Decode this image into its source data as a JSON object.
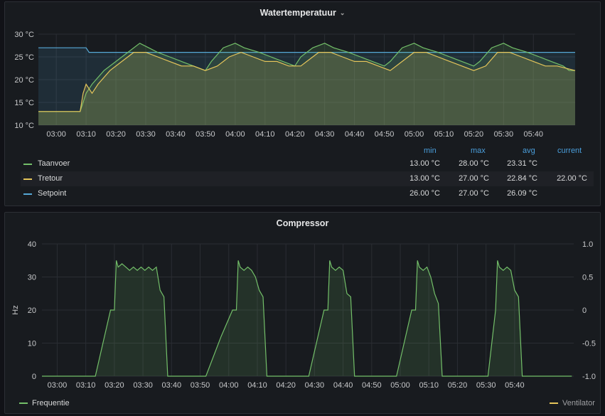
{
  "colors": {
    "taanvoer": "#73bf69",
    "tretour": "#e5c55a",
    "setpoint": "#56a8d6",
    "frequentie": "#73bf69",
    "ventilator": "#e5c55a"
  },
  "panel_top": {
    "title": "Watertemperatuur",
    "caret_icon": "chevron-down-icon",
    "y_ticks": [
      "30 °C",
      "25 °C",
      "20 °C",
      "15 °C",
      "10 °C"
    ],
    "x_ticks": [
      "03:00",
      "03:10",
      "03:20",
      "03:30",
      "03:40",
      "03:50",
      "04:00",
      "04:10",
      "04:20",
      "04:30",
      "04:40",
      "04:50",
      "05:00",
      "05:10",
      "05:20",
      "05:30",
      "05:40"
    ],
    "legend_headers": {
      "min": "min",
      "max": "max",
      "avg": "avg",
      "current": "current"
    },
    "legend": [
      {
        "name": "Taanvoer",
        "min": "13.00 °C",
        "max": "28.00 °C",
        "avg": "23.31 °C",
        "current": ""
      },
      {
        "name": "Tretour",
        "min": "13.00 °C",
        "max": "27.00 °C",
        "avg": "22.84 °C",
        "current": "22.00 °C"
      },
      {
        "name": "Setpoint",
        "min": "26.00 °C",
        "max": "27.00 °C",
        "avg": "26.09 °C",
        "current": ""
      }
    ]
  },
  "panel_bottom": {
    "title": "Compressor",
    "y_left_label": "Hz",
    "y_left_ticks": [
      "40",
      "30",
      "20",
      "10",
      "0"
    ],
    "y_right_ticks": [
      "1.0",
      "0.5",
      "0",
      "-0.5",
      "-1.0"
    ],
    "x_ticks": [
      "03:00",
      "03:10",
      "03:20",
      "03:30",
      "03:40",
      "03:50",
      "04:00",
      "04:10",
      "04:20",
      "04:30",
      "04:40",
      "04:50",
      "05:00",
      "05:10",
      "05:20",
      "05:30",
      "05:40"
    ],
    "legend_left": "Frequentie",
    "legend_right": "Ventilator"
  },
  "chart_data": [
    {
      "type": "line",
      "title": "Watertemperatuur",
      "ylim": [
        10,
        30
      ],
      "x_unit": "minutes since 02:54",
      "series": [
        {
          "name": "Taanvoer",
          "points": [
            [
              0,
              13
            ],
            [
              14,
              13
            ],
            [
              16,
              17
            ],
            [
              18,
              19
            ],
            [
              22,
              22
            ],
            [
              26,
              24
            ],
            [
              30,
              26
            ],
            [
              34,
              28
            ],
            [
              37,
              27
            ],
            [
              40,
              26
            ],
            [
              44,
              25
            ],
            [
              48,
              24
            ],
            [
              52,
              23
            ],
            [
              56,
              22
            ],
            [
              58,
              24
            ],
            [
              62,
              27
            ],
            [
              66,
              28
            ],
            [
              69,
              27
            ],
            [
              74,
              26
            ],
            [
              78,
              25
            ],
            [
              82,
              24
            ],
            [
              86,
              23
            ],
            [
              88,
              25
            ],
            [
              92,
              27
            ],
            [
              96,
              28
            ],
            [
              99,
              27
            ],
            [
              104,
              26
            ],
            [
              108,
              25
            ],
            [
              112,
              24
            ],
            [
              116,
              23
            ],
            [
              118,
              24
            ],
            [
              122,
              27
            ],
            [
              126,
              28
            ],
            [
              129,
              27
            ],
            [
              134,
              26
            ],
            [
              138,
              25
            ],
            [
              142,
              24
            ],
            [
              146,
              23
            ],
            [
              148,
              24
            ],
            [
              152,
              27
            ],
            [
              156,
              28
            ],
            [
              159,
              27
            ],
            [
              164,
              26
            ],
            [
              168,
              25
            ],
            [
              172,
              24
            ],
            [
              176,
              23
            ],
            [
              178,
              22
            ],
            [
              180,
              22
            ]
          ]
        },
        {
          "name": "Tretour",
          "points": [
            [
              0,
              13
            ],
            [
              14,
              13
            ],
            [
              15,
              17
            ],
            [
              16,
              19
            ],
            [
              17,
              18
            ],
            [
              18,
              17
            ],
            [
              20,
              19
            ],
            [
              24,
              22
            ],
            [
              28,
              24
            ],
            [
              32,
              26
            ],
            [
              36,
              26
            ],
            [
              40,
              25
            ],
            [
              44,
              24
            ],
            [
              48,
              23
            ],
            [
              52,
              23
            ],
            [
              56,
              22
            ],
            [
              60,
              23
            ],
            [
              64,
              25
            ],
            [
              68,
              26
            ],
            [
              72,
              25
            ],
            [
              76,
              24
            ],
            [
              80,
              24
            ],
            [
              84,
              23
            ],
            [
              88,
              23
            ],
            [
              90,
              24
            ],
            [
              94,
              26
            ],
            [
              98,
              26
            ],
            [
              102,
              25
            ],
            [
              106,
              24
            ],
            [
              110,
              24
            ],
            [
              114,
              23
            ],
            [
              118,
              22
            ],
            [
              122,
              24
            ],
            [
              126,
              26
            ],
            [
              130,
              26
            ],
            [
              134,
              25
            ],
            [
              138,
              24
            ],
            [
              142,
              23
            ],
            [
              146,
              22
            ],
            [
              150,
              23
            ],
            [
              154,
              26
            ],
            [
              158,
              26
            ],
            [
              162,
              25
            ],
            [
              166,
              24
            ],
            [
              170,
              23
            ],
            [
              174,
              23
            ],
            [
              180,
              22
            ]
          ]
        },
        {
          "name": "Setpoint",
          "points": [
            [
              0,
              27
            ],
            [
              16,
              27
            ],
            [
              17,
              26
            ],
            [
              180,
              26
            ]
          ]
        }
      ]
    },
    {
      "type": "area",
      "title": "Compressor",
      "ylabel": "Hz",
      "ylim": [
        0,
        40
      ],
      "x_unit": "minutes since 02:56",
      "series": [
        {
          "name": "Frequentie",
          "points": [
            [
              0,
              0
            ],
            [
              14,
              0
            ],
            [
              18,
              20
            ],
            [
              19,
              20
            ],
            [
              19.5,
              35
            ],
            [
              20,
              33
            ],
            [
              21,
              34
            ],
            [
              22,
              33
            ],
            [
              23,
              32
            ],
            [
              24,
              33
            ],
            [
              25,
              32
            ],
            [
              26,
              33
            ],
            [
              27,
              32
            ],
            [
              28,
              33
            ],
            [
              29,
              32
            ],
            [
              30,
              33
            ],
            [
              31,
              26
            ],
            [
              32,
              24
            ],
            [
              33,
              0
            ],
            [
              43,
              0
            ],
            [
              47,
              12
            ],
            [
              50,
              20
            ],
            [
              51,
              20
            ],
            [
              51.5,
              35
            ],
            [
              52,
              33
            ],
            [
              53,
              32
            ],
            [
              54,
              33
            ],
            [
              55,
              32
            ],
            [
              56,
              30
            ],
            [
              57,
              26
            ],
            [
              58,
              24
            ],
            [
              59,
              0
            ],
            [
              70,
              0
            ],
            [
              74,
              20
            ],
            [
              75,
              20
            ],
            [
              75.5,
              35
            ],
            [
              76,
              33
            ],
            [
              77,
              32
            ],
            [
              78,
              33
            ],
            [
              79,
              32
            ],
            [
              80,
              25
            ],
            [
              81,
              24
            ],
            [
              82,
              0
            ],
            [
              93,
              0
            ],
            [
              97,
              20
            ],
            [
              98,
              20
            ],
            [
              98.5,
              35
            ],
            [
              99,
              33
            ],
            [
              100,
              32
            ],
            [
              101,
              33
            ],
            [
              102,
              30
            ],
            [
              103,
              25
            ],
            [
              104,
              22
            ],
            [
              105,
              0
            ],
            [
              117,
              0
            ],
            [
              119,
              20
            ],
            [
              119.5,
              35
            ],
            [
              120,
              33
            ],
            [
              121,
              32
            ],
            [
              122,
              33
            ],
            [
              123,
              32
            ],
            [
              124,
              26
            ],
            [
              125,
              24
            ],
            [
              126,
              0
            ],
            [
              139,
              0
            ]
          ]
        },
        {
          "name": "Ventilator",
          "points": []
        }
      ]
    }
  ]
}
